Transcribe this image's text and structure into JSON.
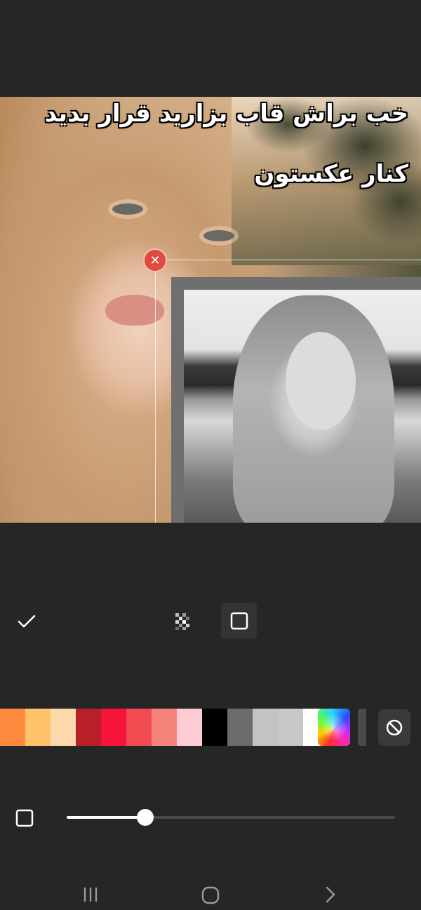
{
  "caption": {
    "line1": "خب براش قاب بزارید قرار بدید",
    "line2": "کنار عکستون"
  },
  "canvas": {
    "close_icon": "close-icon",
    "frame_color": "#6f6f6f"
  },
  "toolbar": {
    "confirm_icon": "check-icon",
    "pattern_icon": "checkerboard-icon",
    "solid_icon": "square-icon",
    "selected": "solid"
  },
  "swatches": {
    "colors": [
      "#ff8a3d",
      "#ffc46b",
      "#fcd9ad",
      "#b8202a",
      "#f5153a",
      "#f24b52",
      "#f7847a",
      "#fdcbd4",
      "#000000",
      "#6b6b6b",
      "#c3c3c3",
      "#c8c8c8",
      "#ffffff"
    ],
    "custom_icon": "rainbow-palette-icon",
    "none_icon": "no-color-icon",
    "accent": "#e04b3f"
  },
  "slider": {
    "icon": "square-outline-icon",
    "value_percent": 24
  },
  "navbar": {
    "recent_icon": "recent-apps-icon",
    "home_icon": "home-icon",
    "back_icon": "back-icon"
  }
}
